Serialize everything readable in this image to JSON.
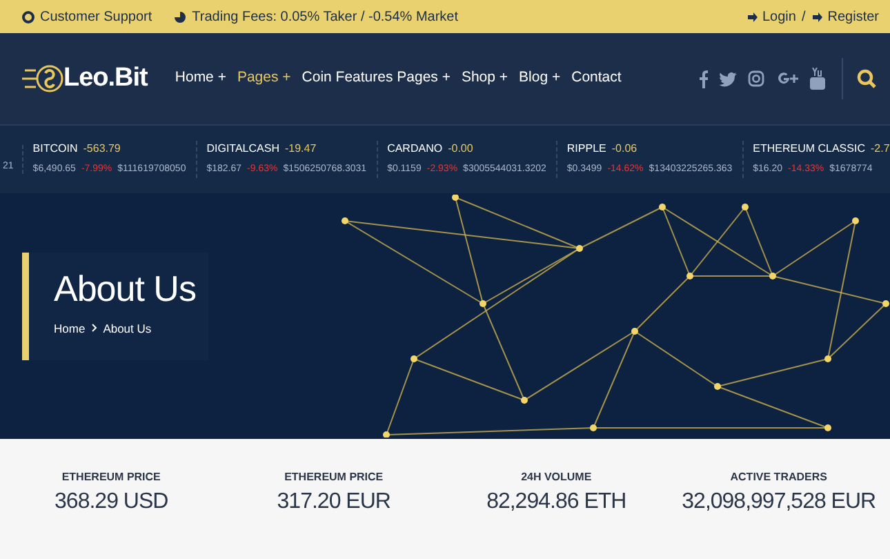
{
  "top_bar": {
    "support": "Customer Support",
    "fees": "Trading Fees: 0.05% Taker / -0.54% Market",
    "login": "Login",
    "separator": "/",
    "register": "Register"
  },
  "nav": {
    "logo": "Leo.Bit",
    "items": [
      {
        "label": "Home +",
        "selected": false
      },
      {
        "label": "Pages +",
        "selected": true
      },
      {
        "label": "Coin Features Pages +",
        "selected": false
      },
      {
        "label": "Shop +",
        "selected": false
      },
      {
        "label": "Blog +",
        "selected": false
      },
      {
        "label": "Contact",
        "selected": false
      }
    ],
    "social": [
      {
        "kind": "facebook"
      },
      {
        "kind": "twitter"
      },
      {
        "kind": "instagram"
      },
      {
        "kind": "googleplus"
      },
      {
        "kind": "youtube"
      }
    ]
  },
  "ticker": [
    {
      "volume": "21"
    },
    {
      "name": "BITCOIN",
      "change": "-563.79",
      "price": "$6,490.65",
      "percent": "-7.99%",
      "volume": "$111619708050"
    },
    {
      "name": "DIGITALCASH",
      "change": "-19.47",
      "price": "$182.67",
      "percent": "-9.63%",
      "volume": "$1506250768.3031"
    },
    {
      "name": "CARDANO",
      "change": "-0.00",
      "price": "$0.1159",
      "percent": "-2.93%",
      "volume": "$3005544031.3202"
    },
    {
      "name": "RIPPLE",
      "change": "-0.06",
      "price": "$0.3499",
      "percent": "-14.62%",
      "volume": "$13403225265.363"
    },
    {
      "name": "ETHEREUM CLASSIC",
      "change": "-2.7",
      "price": "$16.20",
      "percent": "-14.33%",
      "volume": "$1678774"
    }
  ],
  "hero": {
    "title": "About Us",
    "breadcrumb": [
      {
        "label": "Home"
      },
      {
        "label": "About Us"
      }
    ]
  },
  "stats": [
    {
      "label": "ETHEREUM PRICE",
      "value": "368.29 USD"
    },
    {
      "label": "ETHEREUM PRICE",
      "value": "317.20 EUR"
    },
    {
      "label": "24H VOLUME",
      "value": "82,294.86 ETH"
    },
    {
      "label": "ACTIVE TRADERS",
      "value": "32,098,997,528 EUR"
    }
  ]
}
